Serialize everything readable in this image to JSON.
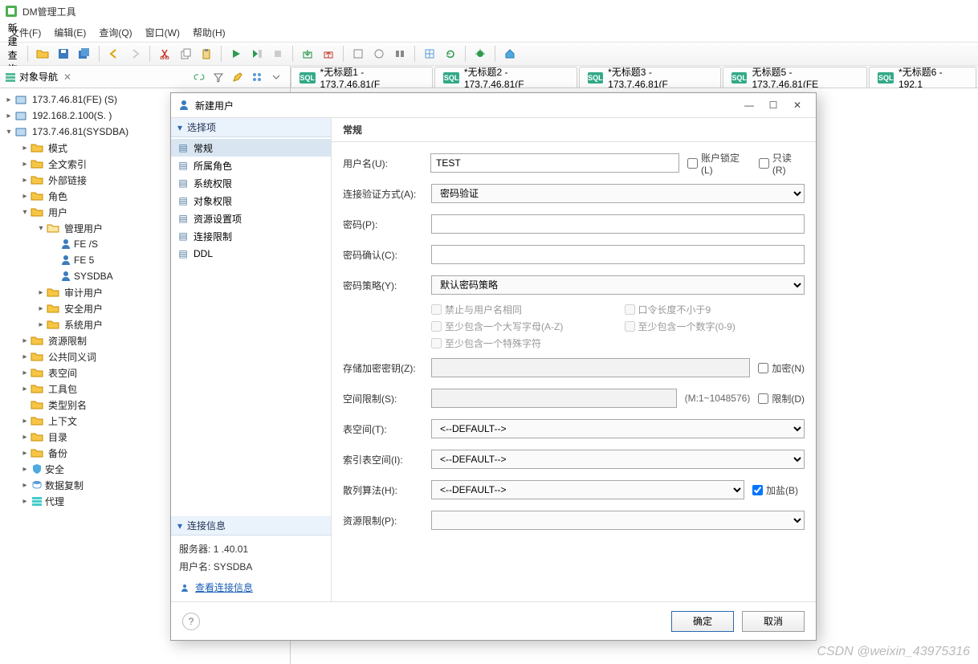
{
  "app": {
    "title": "DM管理工具"
  },
  "menu": {
    "file": "文件(F)",
    "edit": "编辑(E)",
    "query": "查询(Q)",
    "window": "窗口(W)",
    "help": "帮助(H)"
  },
  "toolbar": {
    "new_query": "新建查询(N)"
  },
  "nav": {
    "title": "对象导航",
    "conn1": "173.7.46.81(FE)         (S)",
    "conn2": "192.168.2.100(S.          )",
    "conn3": "173.7.46.81(SYSDBA)",
    "nodes": {
      "schema": "模式",
      "fulltext": "全文索引",
      "extlink": "外部链接",
      "role": "角色",
      "user": "用户",
      "mgmt_user": "管理用户",
      "user1": "FE                  /S",
      "user2": "FE                  5",
      "user3": "SYSDBA",
      "audit_user": "审计用户",
      "security_user": "安全用户",
      "system_user": "系统用户",
      "resource_limit": "资源限制",
      "public_synonym": "公共同义词",
      "tablespace": "表空间",
      "toolkit": "工具包",
      "type_alias": "类型别名",
      "context": "上下文",
      "catalog": "目录",
      "backup": "备份",
      "security": "安全",
      "replication": "数据复制",
      "agent": "代理"
    }
  },
  "tabs": [
    {
      "label": "*无标题1 - 173.7.46.81(F"
    },
    {
      "label": "*无标题2 - 173.7.46.81(F"
    },
    {
      "label": "*无标题3 - 173.7.46.81(F"
    },
    {
      "label": "无标题5 - 173.7.46.81(FE"
    },
    {
      "label": "*无标题6 - 192.1"
    }
  ],
  "dialog": {
    "title": "新建用户",
    "options_header": "选择项",
    "options": [
      "常规",
      "所属角色",
      "系统权限",
      "对象权限",
      "资源设置项",
      "连接限制",
      "DDL"
    ],
    "conn_header": "连接信息",
    "server_label": "服务器:",
    "server_value": "1      .40.01",
    "user_label": "用户名:",
    "user_value": "SYSDBA",
    "view_conn": "查看连接信息",
    "form_header": "常规",
    "labels": {
      "username": "用户名(U):",
      "lock": "账户锁定(L)",
      "readonly": "只读(R)",
      "auth": "连接验证方式(A):",
      "password": "密码(P):",
      "password_confirm": "密码确认(C):",
      "policy": "密码策略(Y):",
      "p1": "禁止与用户名相同",
      "p2": "口令长度不小于9",
      "p3": "至少包含一个大写字母(A-Z)",
      "p4": "至少包含一个数字(0-9)",
      "p5": "至少包含一个特殊字符",
      "enc_key": "存储加密密钥(Z):",
      "encrypt": "加密(N)",
      "space_limit": "空间限制(S):",
      "space_hint": "(M:1~1048576)",
      "limit": "限制(D)",
      "tablespace": "表空间(T):",
      "index_tablespace": "索引表空间(I):",
      "hash": "散列算法(H):",
      "salt": "加盐(B)",
      "resource_limit": "资源限制(P):"
    },
    "values": {
      "username": "TEST",
      "auth": "密码验证",
      "policy": "默认密码策略",
      "tablespace": "<--DEFAULT-->",
      "index_tablespace": "<--DEFAULT-->",
      "hash": "<--DEFAULT-->",
      "salt_checked": true
    },
    "buttons": {
      "ok": "确定",
      "cancel": "取消"
    }
  },
  "watermark": "CSDN @weixin_43975316"
}
